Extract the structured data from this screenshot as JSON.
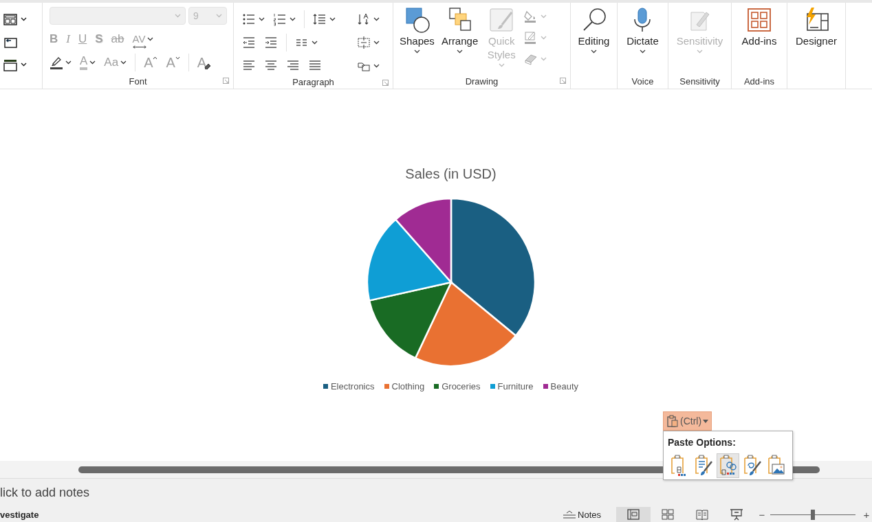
{
  "ribbon": {
    "groups": [
      {
        "kind": "slides",
        "buttons": [
          {
            "kind": "layout",
            "dropdown": true
          },
          {
            "kind": "reset",
            "dropdown": false
          },
          {
            "kind": "section",
            "dropdown": true
          }
        ]
      },
      {
        "kind": "font",
        "label": "Font",
        "disabled": true,
        "launcher": true,
        "font_size": "9",
        "row2": [
          {
            "kind": "bold",
            "glyph": "B"
          },
          {
            "kind": "italic",
            "glyph": "I"
          },
          {
            "kind": "underline",
            "glyph": "U"
          },
          {
            "kind": "shadow",
            "glyph": "S"
          },
          {
            "kind": "strike",
            "glyph": "ab"
          },
          {
            "kind": "spacing",
            "glyph": "AV",
            "dropdown": true
          }
        ],
        "row3": [
          {
            "kind": "highlight",
            "dropdown": true
          },
          {
            "kind": "color",
            "glyph": "A",
            "dropdown": true
          },
          {
            "kind": "case",
            "glyph": "Aa",
            "dropdown": true
          },
          {
            "kind": "grow",
            "glyph": "A"
          },
          {
            "kind": "shrink",
            "glyph": "A"
          },
          {
            "kind": "clear",
            "glyph": "A"
          }
        ]
      },
      {
        "kind": "paragraph",
        "label": "Paragraph",
        "disabled": true,
        "launcher": true
      },
      {
        "kind": "drawing",
        "label": "Drawing",
        "launcher": true,
        "buttons": [
          {
            "kind": "shapes",
            "label": "Shapes",
            "dropdown": true,
            "disabled": false
          },
          {
            "kind": "arrange",
            "label": "Arrange",
            "dropdown": true,
            "disabled": false
          },
          {
            "kind": "quick_styles",
            "label": "Quick Styles",
            "dropdown": true,
            "disabled": true
          }
        ],
        "small_tools": [
          {
            "kind": "fill",
            "disabled": true
          },
          {
            "kind": "outline",
            "disabled": true
          },
          {
            "kind": "effects",
            "disabled": true
          }
        ]
      },
      {
        "kind": "editing",
        "buttons": [
          {
            "kind": "editing",
            "label": "Editing",
            "dropdown": true,
            "disabled": false
          }
        ]
      },
      {
        "kind": "voice",
        "label": "Voice",
        "buttons": [
          {
            "kind": "dictate",
            "label": "Dictate",
            "dropdown": true,
            "disabled": false
          }
        ]
      },
      {
        "kind": "sensitivity",
        "label": "Sensitivity",
        "buttons": [
          {
            "kind": "sensitivity",
            "label": "Sensitivity",
            "dropdown": true,
            "disabled": true
          }
        ]
      },
      {
        "kind": "addins",
        "label": "Add-ins",
        "buttons": [
          {
            "kind": "addins",
            "label": "Add-ins",
            "dropdown": false,
            "disabled": false
          }
        ]
      },
      {
        "kind": "designer",
        "buttons": [
          {
            "kind": "designer",
            "label": "Designer",
            "dropdown": false,
            "disabled": false
          }
        ]
      }
    ]
  },
  "slide": {
    "chart_data": {
      "type": "pie",
      "title": "Sales (in USD)",
      "legend": "bottom",
      "categories": [
        "Electronics",
        "Clothing",
        "Groceries",
        "Furniture",
        "Beauty"
      ],
      "values": [
        36,
        21,
        14.5,
        17,
        11.5
      ],
      "colors": [
        "#1a5f82",
        "#e97132",
        "#196b24",
        "#0f9ed5",
        "#a02b93"
      ]
    }
  },
  "paste_options": {
    "button": "(Ctrl)",
    "title": "Paste Options:",
    "options": [
      {
        "kind": "destination",
        "selected": false
      },
      {
        "kind": "source",
        "selected": false
      },
      {
        "kind": "embed",
        "selected": true
      },
      {
        "kind": "theme",
        "selected": false
      },
      {
        "kind": "picture",
        "selected": false
      }
    ]
  },
  "notes": {
    "placeholder": "lick to add notes"
  },
  "status_bar": {
    "left": "vestigate",
    "notes_button": "Notes",
    "views": [
      {
        "kind": "normal",
        "selected": true
      },
      {
        "kind": "sorter",
        "selected": false
      },
      {
        "kind": "reading",
        "selected": false
      },
      {
        "kind": "show",
        "selected": false
      }
    ],
    "zoom_out": "−",
    "zoom_in": "+",
    "zoom": {
      "level": 0.5
    }
  }
}
